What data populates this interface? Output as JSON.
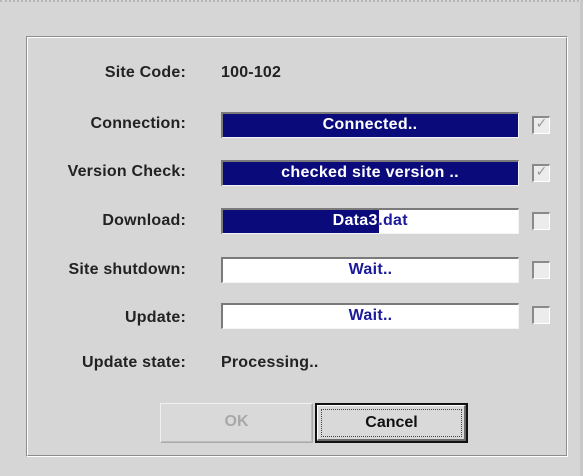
{
  "site_code": {
    "label": "Site Code:",
    "value": "100-102"
  },
  "connection": {
    "label": "Connection:",
    "status": "Connected..",
    "progress": 1.0,
    "checked": true
  },
  "version_check": {
    "label": "Version Check:",
    "status": "checked site version ..",
    "progress": 1.0,
    "checked": true
  },
  "download": {
    "label": "Download:",
    "status": "Data3.dat",
    "progress": 0.53,
    "checked": false
  },
  "site_shutdown": {
    "label": "Site shutdown:",
    "status": "Wait..",
    "progress": 0.0,
    "checked": false
  },
  "update": {
    "label": "Update:",
    "status": "Wait..",
    "progress": 0.0,
    "checked": false
  },
  "update_state": {
    "label": "Update state:",
    "value": "Processing.."
  },
  "buttons": {
    "ok_label": "OK",
    "cancel_label": "Cancel"
  },
  "colors": {
    "progress_fill": "#0a0a7a",
    "progress_text": "#1a1a9a",
    "dialog_bg": "#d6d6d6"
  }
}
